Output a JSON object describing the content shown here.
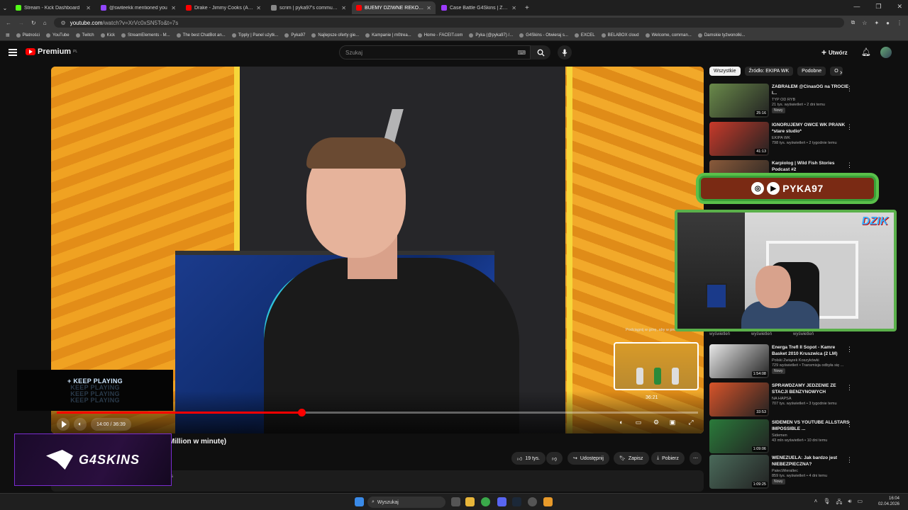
{
  "browser": {
    "tabs": [
      {
        "title": "Stream - Kick Dashboard",
        "color": "#53fc18",
        "active": false
      },
      {
        "title": "@switeekk mentioned you",
        "color": "#9146ff",
        "active": false
      },
      {
        "title": "Drake - Jimmy Cooks (Audio) ft",
        "color": "#ff0000",
        "active": false
      },
      {
        "title": "scrim | pyka97's community",
        "color": "#888888",
        "active": false
      },
      {
        "title": "BUEMY DZIWNE REKORDY ŚWI",
        "color": "#ff0000",
        "active": true
      },
      {
        "title": "Case Battle G4Skins | Zdobywaj",
        "color": "#9d3bff",
        "active": false
      }
    ],
    "url_host": "youtube.com",
    "url_path": "/watch?v=XrVc0xSN5To&t=7s",
    "bookmarks": [
      "Płatności",
      "YouTube",
      "Twitch",
      "Kick",
      "StreamElements - M...",
      "The best ChatBot an...",
      "Tipply | Panel użytk...",
      "Pyka97",
      "Najlepsze oferty gie...",
      "Kampanie | m0trea...",
      "Home - FACEIT.com",
      "Pyka (@pyka97) /...",
      "G4Skins - Otwieraj s...",
      "EXCEL",
      "BELABOX cloud",
      "Welcome, comman...",
      "Damskie tyźwonolki..."
    ]
  },
  "yt": {
    "logo": "Premium",
    "logo_sup": "PL",
    "search_placeholder": "Szukaj",
    "create_label": "Utwórz"
  },
  "player": {
    "time_current": "14:00",
    "time_total": "36:39",
    "time_display": "14:00 / 36:39",
    "progress": 0.382,
    "preview_hint": "Podciągnij w górę, aby w precyzyjnie",
    "preview_time": "36:21"
  },
  "overlays": {
    "keep_playing": "KEEP PLAYING",
    "g4skins": "G4SKINS",
    "banner_name": "PYKA97",
    "cam_logo": "DZIK"
  },
  "video": {
    "title_fragment": "Million w minutę)",
    "actions": {
      "like": "19 tys.",
      "share": "Udostępnij",
      "save": "Zapisz",
      "download": "Pobierz"
    },
    "desc_fragment": "ks"
  },
  "sidebar": {
    "chips": [
      "Wszystkie",
      "Źródło: EKIPA WK",
      "Podobne",
      "O"
    ],
    "recs": [
      {
        "title": "ZABRAŁEM @CinasOG na TROCIE I...",
        "channel": "TYP OD RYB",
        "stats": "21 tys. wyświetleń • 2 dni temu",
        "badge": "Nowy",
        "duration": "25:16",
        "thumb": "#6a8a4a"
      },
      {
        "title": "IGNORUJEMY OWCE WK PRANK *stare studio*",
        "channel": "EKIPA WK",
        "stats": "798 tys. wyświetleń • 2 tygodnie temu",
        "badge": "",
        "duration": "41:13",
        "thumb": "#c83a2a"
      },
      {
        "title": "Karpiolog | Wild Fish Stories Podcast #2",
        "channel": "",
        "stats": "",
        "badge": "",
        "duration": "",
        "thumb": "#8a5a3a"
      },
      {
        "title": "Energa Trefl II Sopot - Kamre Basket 2010 Kruszwica (2 LM)",
        "channel": "Polski Związek Koszykówki",
        "stats": "729 wyświetleń • Transmisja odbyła się ...",
        "badge": "Nowy",
        "duration": "1:54:08",
        "thumb": "#e8e8e8"
      },
      {
        "title": "SPRAWDZAMY JEDZENIE ZE STACJI BENZYNOWYCH",
        "channel": "NA HAPSA",
        "stats": "707 tys. wyświetleń • 3 tygodnie temu",
        "badge": "",
        "duration": "33:53",
        "thumb": "#d8542a"
      },
      {
        "title": "SIDEMEN VS YOUTUBE ALLSTARS IMPOSSIBLE ...",
        "channel": "Sidemen",
        "stats": "43 mln wyświetleń • 10 dni temu",
        "badge": "",
        "duration": "1:09:06",
        "thumb": "#2a7a3a"
      },
      {
        "title": "WENEZUELA: Jak bardzo jest NIEBEZPIECZNA?",
        "channel": "PatecWieraltec",
        "stats": "859 tys. wyświetleń • 4 dni temu",
        "badge": "Nowy",
        "duration": "1:09:25",
        "thumb": "#4a6a5a"
      }
    ],
    "hidden_meta": [
      "wyświetleń",
      "wyświetleń",
      "wyświetleń"
    ]
  },
  "taskbar": {
    "search": "Wyszukaj",
    "time": "16:04",
    "date": "02.04.2026"
  }
}
